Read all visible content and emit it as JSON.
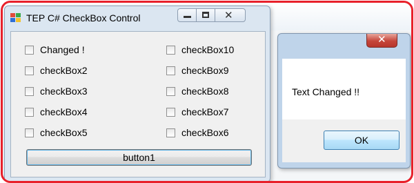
{
  "main_window": {
    "title": "TEP C# CheckBox Control",
    "checkboxes_left": [
      {
        "label": "Changed !"
      },
      {
        "label": "checkBox2"
      },
      {
        "label": "checkBox3"
      },
      {
        "label": "checkBox4"
      },
      {
        "label": "checkBox5"
      }
    ],
    "checkboxes_right": [
      {
        "label": "checkBox10"
      },
      {
        "label": "checkBox9"
      },
      {
        "label": "checkBox8"
      },
      {
        "label": "checkBox7"
      },
      {
        "label": "checkBox6"
      }
    ],
    "button_label": "button1"
  },
  "message_box": {
    "text": "Text Changed !!",
    "ok_label": "OK"
  },
  "colors": {
    "frame": "#e8202a",
    "close_button": "#c5453a"
  }
}
